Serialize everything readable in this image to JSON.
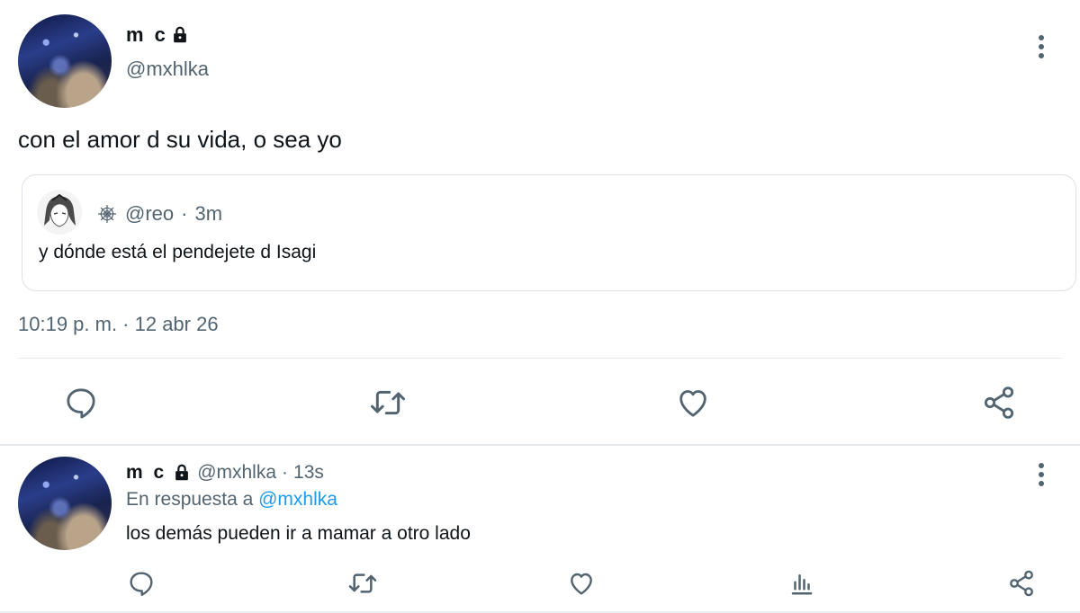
{
  "main_tweet": {
    "display_name": "m c",
    "handle": "@mxhlka",
    "text": "con el amor d su vida, o sea yo",
    "quote": {
      "handle": "@reo",
      "separator": "·",
      "age": "3m",
      "text": "y dónde está el pendejete d Isagi"
    },
    "timestamp": "10:19 p. m. · 12 abr 26",
    "actions": [
      "reply-icon",
      "retweet-icon",
      "like-icon",
      "share-icon"
    ]
  },
  "reply_tweet": {
    "display_name": "m c",
    "handle": "@mxhlka",
    "separator": "·",
    "age": "13s",
    "reply_prefix": "En respuesta a",
    "reply_mention": "@mxhlka",
    "text": "los demás pueden ir a mamar a otro lado",
    "actions": [
      "reply-icon",
      "retweet-icon",
      "like-icon",
      "analytics-icon",
      "share-icon"
    ]
  },
  "colors": {
    "text": "#0f1419",
    "secondary": "#536471",
    "mention": "#1d9bf0",
    "border": "#dbe1e6"
  }
}
